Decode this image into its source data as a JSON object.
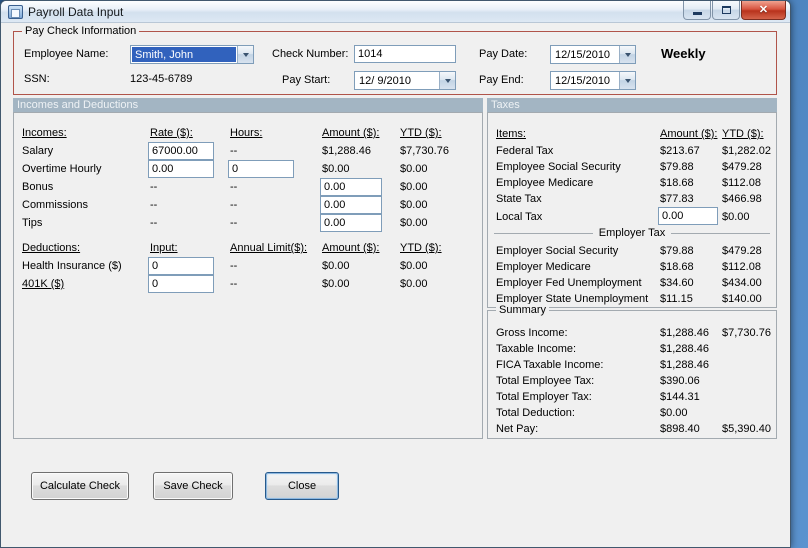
{
  "window": {
    "title": "Payroll Data Input",
    "close_glyph": "✕"
  },
  "paycheck": {
    "group_label": "Pay Check Information",
    "fields": {
      "employee_name": {
        "label": "Employee Name:",
        "value": "Smith, John"
      },
      "ssn": {
        "label": "SSN:",
        "value": "123-45-6789"
      },
      "check_number": {
        "label": "Check Number:",
        "value": "1014"
      },
      "pay_start": {
        "label": "Pay Start:",
        "value": "12/ 9/2010"
      },
      "pay_date": {
        "label": "Pay Date:",
        "value": "12/15/2010"
      },
      "pay_end": {
        "label": "Pay End:",
        "value": "12/15/2010"
      }
    },
    "frequency": "Weekly"
  },
  "section_headers": {
    "left": "Incomes and Deductions",
    "right": "Taxes"
  },
  "incomes": {
    "headers": {
      "c0": "Incomes:",
      "c1": "Rate ($):",
      "c2": "Hours:",
      "c3": "Amount ($):",
      "c4": "YTD ($):"
    },
    "rows": [
      {
        "label": "Salary",
        "rate": "67000.00",
        "hours": "--",
        "amount": "$1,288.46",
        "ytd": "$7,730.76"
      },
      {
        "label": "Overtime Hourly",
        "rate": "0.00",
        "hours": "0",
        "amount": "$0.00",
        "ytd": "$0.00"
      },
      {
        "label": "Bonus",
        "rate": "--",
        "hours": "--",
        "amount": "0.00",
        "ytd": "$0.00"
      },
      {
        "label": "Commissions",
        "rate": "--",
        "hours": "--",
        "amount": "0.00",
        "ytd": "$0.00"
      },
      {
        "label": "Tips",
        "rate": "--",
        "hours": "--",
        "amount": "0.00",
        "ytd": "$0.00"
      }
    ]
  },
  "deductions": {
    "headers": {
      "c0": "Deductions:",
      "c1": "Input:",
      "c2": "Annual Limit($):",
      "c3": "Amount ($):",
      "c4": "YTD ($):"
    },
    "rows": [
      {
        "label": "Health Insurance  ($)",
        "input": "0",
        "limit": "--",
        "amount": "$0.00",
        "ytd": "$0.00"
      },
      {
        "label": "401K  ($)",
        "input": "0",
        "limit": "--",
        "amount": "$0.00",
        "ytd": "$0.00"
      }
    ]
  },
  "taxes": {
    "headers": {
      "c0": "Items:",
      "c1": "Amount ($):",
      "c2": "YTD ($):"
    },
    "employee_rows": [
      {
        "label": "Federal Tax",
        "amount": "$213.67",
        "ytd": "$1,282.02"
      },
      {
        "label": "Employee Social Security",
        "amount": "$79.88",
        "ytd": "$479.28"
      },
      {
        "label": "Employee Medicare",
        "amount": "$18.68",
        "ytd": "$112.08"
      },
      {
        "label": "State Tax",
        "amount": "$77.83",
        "ytd": "$466.98"
      }
    ],
    "local_tax": {
      "label": "Local Tax",
      "amount": "0.00",
      "ytd": "$0.00"
    },
    "employer_separator": "Employer Tax",
    "employer_rows": [
      {
        "label": "Employer Social Security",
        "amount": "$79.88",
        "ytd": "$479.28"
      },
      {
        "label": "Employer Medicare",
        "amount": "$18.68",
        "ytd": "$112.08"
      },
      {
        "label": "Employer Fed Unemployment",
        "amount": "$34.60",
        "ytd": "$434.00"
      },
      {
        "label": "Employer State Unemployment",
        "amount": "$11.15",
        "ytd": "$140.00"
      }
    ]
  },
  "summary": {
    "group_label": "Summary",
    "rows": [
      {
        "label": "Gross Income:",
        "amount": "$1,288.46",
        "ytd": "$7,730.76"
      },
      {
        "label": "Taxable Income:",
        "amount": "$1,288.46",
        "ytd": ""
      },
      {
        "label": "FICA Taxable Income:",
        "amount": "$1,288.46",
        "ytd": ""
      },
      {
        "label": "Total Employee Tax:",
        "amount": "$390.06",
        "ytd": ""
      },
      {
        "label": "Total Employer Tax:",
        "amount": "$144.31",
        "ytd": ""
      },
      {
        "label": "Total Deduction:",
        "amount": "$0.00",
        "ytd": ""
      },
      {
        "label": "Net Pay:",
        "amount": "$898.40",
        "ytd": "$5,390.40"
      }
    ]
  },
  "buttons": {
    "calculate": "Calculate Check",
    "save": "Save Check",
    "close": "Close"
  },
  "colors": {
    "band": "#a3b5c3",
    "pc-border": "#b0544a",
    "sel-blue": "#3162bd",
    "close-red": "#d85440"
  }
}
